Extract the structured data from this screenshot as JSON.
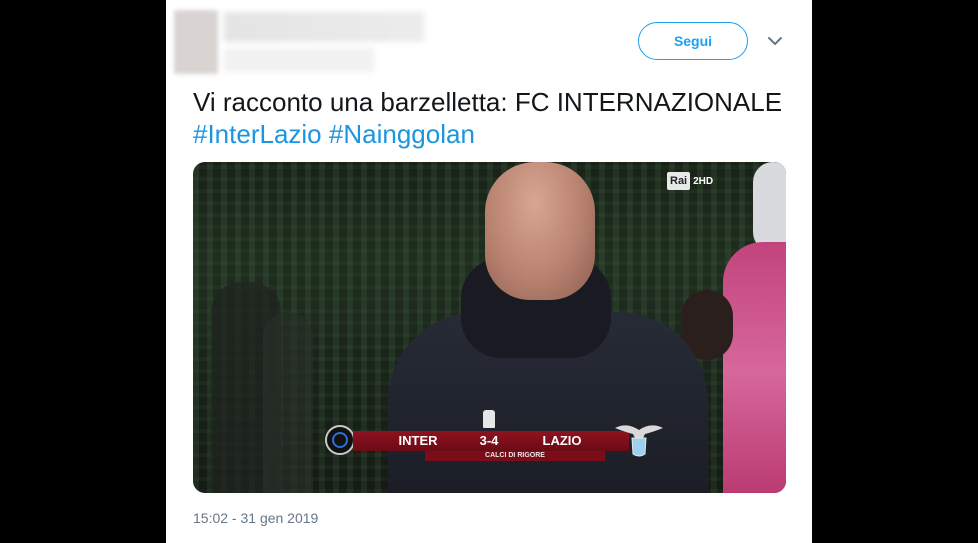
{
  "header": {
    "follow_label": "Segui"
  },
  "tweet": {
    "text_plain": "Vi racconto una barzelletta: FC INTERNAZIONALE ",
    "hashtags": [
      "#InterLazio",
      "#Nainggolan"
    ],
    "timestamp": "15:02 - 31 gen 2019"
  },
  "media": {
    "broadcaster": {
      "name": "Rai",
      "channel": "2HD"
    },
    "scoreboard": {
      "home": "INTER",
      "result": "3-4",
      "away": "LAZIO",
      "subtitle": "CALCI DI RIGORE"
    }
  },
  "colors": {
    "accent": "#1da1f2",
    "hashtag": "#1b95e0",
    "text": "#14171a",
    "muted": "#657786",
    "score_bar": "#8f1220"
  },
  "icons": {
    "menu": "chevron-down-icon"
  }
}
